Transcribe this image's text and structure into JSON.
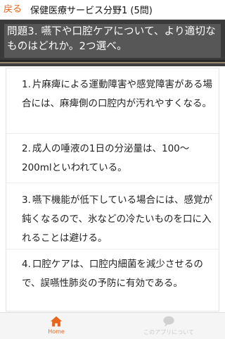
{
  "header": {
    "back_label": "戻る",
    "title": "保健医療サービス分野1 (5問)"
  },
  "question": {
    "text": "問題3. 嚥下や口腔ケアについて、より適切なものはどれか。2つ選べ。"
  },
  "answers": [
    {
      "number": "1.",
      "text": "片麻痺による運動障害や感覚障害がある場合には、麻痺側の口腔内が汚れやすくなる。"
    },
    {
      "number": "2.",
      "text": "成人の唾液の1日の分泌量は、100～200mlといわれている。"
    },
    {
      "number": "3.",
      "text": "嚥下機能が低下している場合には、感覚が鈍くなるので、氷などの冷たいものを口に入れることは避ける。"
    },
    {
      "number": "4.",
      "text": "口腔ケアは、口腔内細菌を減少させるので、誤嚥性肺炎の予防に有効である。"
    }
  ],
  "bottom_nav": {
    "home_label": "Home",
    "about_label": "このアプリについて",
    "home_icon": "home-icon",
    "about_icon": "speech-bubble-icon",
    "active_color": "#e8661e",
    "inactive_color": "#c9c9c9"
  }
}
